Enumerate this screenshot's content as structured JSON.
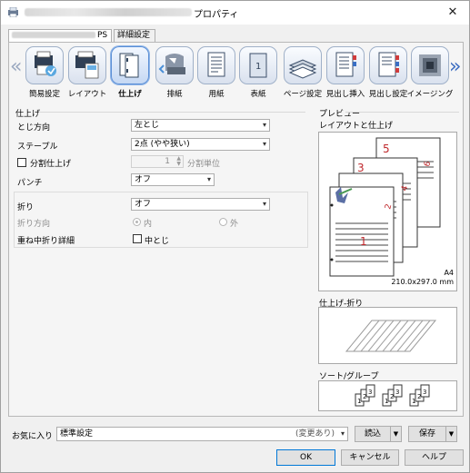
{
  "window": {
    "title_suffix": "プロパティ"
  },
  "tabs": [
    {
      "label": "PS"
    },
    {
      "label": "詳細設定"
    }
  ],
  "toolbar": {
    "items": [
      {
        "label": "簡易設定",
        "icon": "quick-setup-icon"
      },
      {
        "label": "レイアウト",
        "icon": "layout-icon"
      },
      {
        "label": "仕上げ",
        "icon": "finishing-icon",
        "selected": true
      },
      {
        "label": "排紙",
        "icon": "output-icon"
      },
      {
        "label": "用紙",
        "icon": "paper-icon"
      },
      {
        "label": "表紙",
        "icon": "cover-icon"
      },
      {
        "label": "ページ設定",
        "icon": "page-setup-icon"
      },
      {
        "label": "見出し挿入",
        "icon": "tab-insert-icon"
      },
      {
        "label": "見出し設定",
        "icon": "tab-settings-icon"
      },
      {
        "label": "イメージング",
        "icon": "imaging-icon"
      }
    ]
  },
  "finishing": {
    "section_title": "仕上げ",
    "binding_label": "とじ方向",
    "binding_value": "左とじ",
    "staple_label": "ステープル",
    "staple_value": "2点 (やや狭い)",
    "split_label": "分割仕上げ",
    "split_value": "1",
    "split_unit": "分割単位",
    "punch_label": "パンチ",
    "punch_value": "オフ",
    "fold_label": "折り",
    "fold_value": "オフ",
    "fold_direction_label": "折り方向",
    "fold_in_label": "内",
    "fold_out_label": "外",
    "saddle_label": "重ね中折り詳細",
    "saddle_option_label": "中とじ"
  },
  "preview": {
    "section_title": "プレビュー",
    "layout_label": "レイアウトと仕上げ",
    "paper_size": "A4",
    "paper_dimensions": "210.0x297.0 mm",
    "page_numbers": [
      "1",
      "2",
      "3",
      "4",
      "5",
      "6"
    ],
    "fold_label": "仕上げ-折り",
    "sort_label": "ソート/グループ",
    "sort_numbers": [
      "1",
      "2",
      "3",
      "1",
      "2",
      "3",
      "1",
      "2",
      "3"
    ]
  },
  "favorites": {
    "label": "お気に入り",
    "value": "標準設定",
    "changed_note": "(変更あり)",
    "load_label": "読込",
    "save_label": "保存"
  },
  "dialog_buttons": {
    "ok": "OK",
    "cancel": "キャンセル",
    "help": "ヘルプ"
  },
  "colors": {
    "accent": "#0078d7",
    "page_number": "#c0282c",
    "nav_arrow": "#3f6fc2"
  }
}
